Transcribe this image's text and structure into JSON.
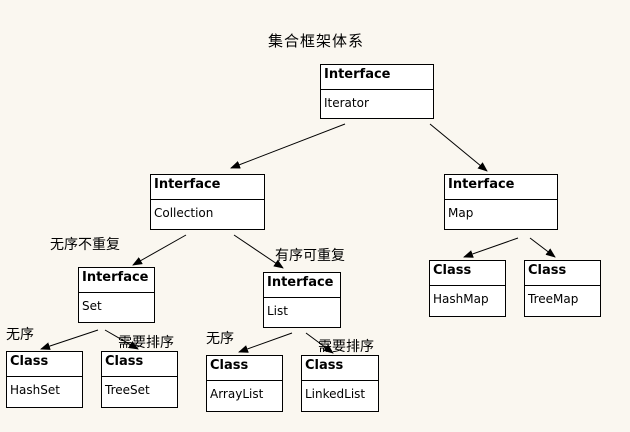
{
  "title": "集合框架体系",
  "nodes": {
    "iterator": {
      "kind": "Interface",
      "name": "Iterator"
    },
    "collection": {
      "kind": "Interface",
      "name": "Collection"
    },
    "map": {
      "kind": "Interface",
      "name": "Map"
    },
    "set": {
      "kind": "Interface",
      "name": "Set"
    },
    "list": {
      "kind": "Interface",
      "name": "List"
    },
    "hashset": {
      "kind": "Class",
      "name": "HashSet"
    },
    "treeset": {
      "kind": "Class",
      "name": "TreeSet"
    },
    "arraylist": {
      "kind": "Class",
      "name": "ArrayList"
    },
    "linkedlist": {
      "kind": "Class",
      "name": "LinkedList"
    },
    "hashmap": {
      "kind": "Class",
      "name": "HashMap"
    },
    "treemap": {
      "kind": "Class",
      "name": "TreeMap"
    }
  },
  "edge_labels": {
    "set_unordered_unique": "无序不重复",
    "list_ordered_repeatable": "有序可重复",
    "hashset_unordered": "无序",
    "treeset_sorted": "需要排序",
    "arraylist_unordered": "无序",
    "linkedlist_sorted": "需要排序"
  },
  "edges": [
    {
      "from": "iterator",
      "to": "collection"
    },
    {
      "from": "iterator",
      "to": "map"
    },
    {
      "from": "collection",
      "to": "set"
    },
    {
      "from": "collection",
      "to": "list"
    },
    {
      "from": "set",
      "to": "hashset"
    },
    {
      "from": "set",
      "to": "treeset"
    },
    {
      "from": "list",
      "to": "arraylist"
    },
    {
      "from": "list",
      "to": "linkedlist"
    },
    {
      "from": "map",
      "to": "hashmap"
    },
    {
      "from": "map",
      "to": "treemap"
    }
  ]
}
